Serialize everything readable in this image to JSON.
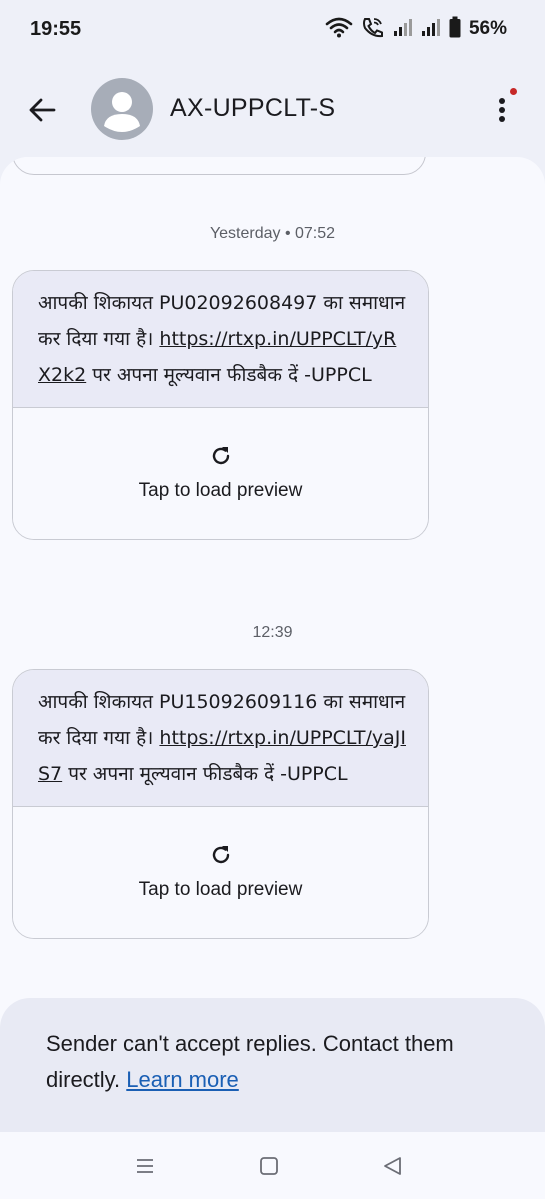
{
  "status_bar": {
    "time": "19:55",
    "battery": "56%",
    "icons": [
      "wifi-icon",
      "wifi-calling-icon",
      "signal-icon",
      "signal-icon",
      "battery-icon"
    ]
  },
  "header": {
    "contact_name": "AX-UPPCLT-S",
    "icons": [
      "back-arrow-icon",
      "avatar-person-icon",
      "more-vert-icon"
    ]
  },
  "messages": [
    {
      "timestamp": "Yesterday • 07:52",
      "text_before": "आपकी शिकायत PU02092608497 का समाधान कर दिया गया है। ",
      "link": "https://rtxp.in/UPPCLT/yRX2k2",
      "text_after": " पर अपना मूल्यवान फीडबैक दें -UPPCL",
      "preview_label": "Tap to load preview"
    },
    {
      "timestamp": "12:39",
      "text_before": "आपकी शिकायत PU15092609116 का समाधान कर दिया गया है। ",
      "link": "https://rtxp.in/UPPCLT/yaJIS7",
      "text_after": " पर अपना मूल्यवान फीडबैक दें -UPPCL",
      "preview_label": "Tap to load preview"
    }
  ],
  "footer_notice": {
    "text": "Sender can't accept replies. Contact them directly. ",
    "link_label": "Learn more"
  },
  "colors": {
    "background": "#eef0f8",
    "bubble": "#e9eaf6",
    "link": "#1a5fb4",
    "notification_dot": "#c62828"
  }
}
